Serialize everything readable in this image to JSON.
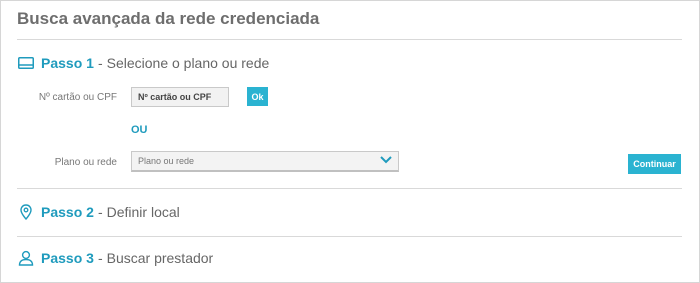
{
  "page": {
    "title": "Busca avançada da rede credenciada"
  },
  "steps": [
    {
      "number": "Passo 1",
      "separator": "-",
      "description": "Selecione o plano ou rede",
      "icon": "card-icon"
    },
    {
      "number": "Passo 2",
      "separator": "-",
      "description": "Definir local",
      "icon": "location-pin-icon"
    },
    {
      "number": "Passo 3",
      "separator": "-",
      "description": "Buscar prestador",
      "icon": "person-icon"
    }
  ],
  "step1": {
    "card_label": "Nº cartão ou CPF",
    "card_placeholder": "Nº cartão ou CPF",
    "ok_label": "Ok",
    "or_label": "OU",
    "plan_label": "Plano ou rede",
    "plan_selected": "Plano ou rede",
    "continue_label": "Continuar"
  },
  "colors": {
    "accent": "#1f9bbd",
    "button": "#2ab3d1"
  }
}
